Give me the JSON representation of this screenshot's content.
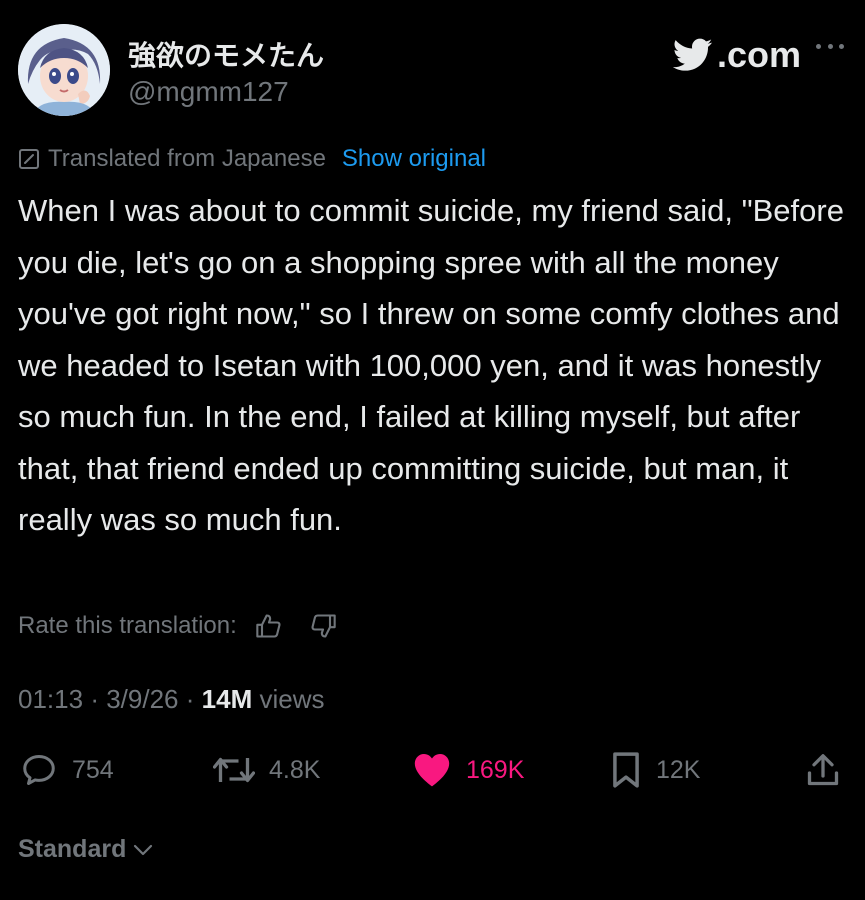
{
  "author": {
    "display_name": "強欲のモメたん",
    "handle": "@mgmm127"
  },
  "brand": {
    "label": ".com",
    "icon": "x-bird-icon"
  },
  "translation": {
    "label": "Translated from Japanese",
    "show_original": "Show original",
    "rate_label": "Rate this translation:"
  },
  "tweet": {
    "text": "When I was about to commit suicide, my friend said, \"Before you die, let's go on a shopping spree with all the money you've got right now,\" so I threw on some comfy clothes and we headed to Isetan with 100,000 yen, and it was honestly so much fun. In the end, I failed at killing myself, but after that, that friend ended up committing suicide, but man, it really was so much fun."
  },
  "meta": {
    "time": "01:13",
    "sep1": "·",
    "date": "3/9/26",
    "sep2": "·",
    "views_count": "14M",
    "views_label": "views"
  },
  "actions": {
    "replies": "754",
    "reposts": "4.8K",
    "likes": "169K",
    "bookmarks": "12K"
  },
  "footer": {
    "standard_label": "Standard"
  },
  "colors": {
    "background": "#000000",
    "text": "#e7e9ea",
    "muted": "#71767b",
    "link": "#1d9bf0",
    "like": "#f91880"
  }
}
